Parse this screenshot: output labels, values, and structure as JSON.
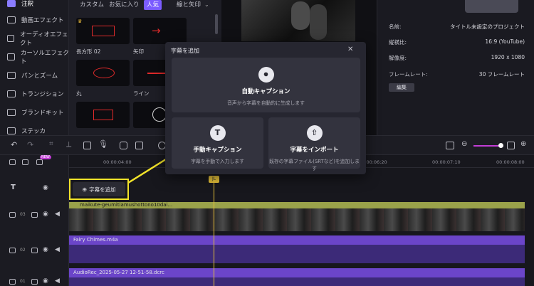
{
  "sidebar": {
    "items": [
      {
        "label": "注釈"
      },
      {
        "label": "動画エフェクト"
      },
      {
        "label": "オーディオエフェクト"
      },
      {
        "label": "カーソルエフェクト"
      },
      {
        "label": "パンとズーム"
      },
      {
        "label": "トランジション"
      },
      {
        "label": "ブランドキット"
      },
      {
        "label": "ステッカ"
      }
    ]
  },
  "assets": {
    "tabs": [
      "カスタム",
      "お気に入り",
      "人気",
      "線と矢印"
    ],
    "active_tab": "人気",
    "items": [
      {
        "label": "長方形 02"
      },
      {
        "label": "矢印"
      },
      {
        "label": "丸"
      },
      {
        "label": "ライン"
      }
    ]
  },
  "properties": {
    "rows": [
      {
        "label": "名前:",
        "value": "タイトル未設定のプロジェクト"
      },
      {
        "label": "縦横比:",
        "value": "16:9 (YouTube)"
      },
      {
        "label": "解像度:",
        "value": "1920 x 1080"
      },
      {
        "label": "フレームレート:",
        "value": "30 フレームレート"
      }
    ],
    "edit_label": "編集"
  },
  "toolbar": {
    "new_badge": "NEW"
  },
  "ruler": {
    "times": [
      "00:00:04:00",
      "00:00:06:20",
      "00:00:07:10",
      "00:00:08:00"
    ]
  },
  "dialog": {
    "title": "字幕を追加",
    "auto": {
      "title": "自動キャプション",
      "desc": "音声から字幕を自動的に生成します"
    },
    "manual": {
      "title": "手動キャプション",
      "desc": "字幕を手動で入力します"
    },
    "import": {
      "title": "字幕をインポート",
      "desc": "既存の字幕ファイル(SRTなど)を追加します"
    }
  },
  "timeline": {
    "add_caption": "字幕を追加",
    "playhead": "JL",
    "tracks": [
      {
        "num": "03",
        "clip": "maikute-geumitiamushottono10dai..."
      },
      {
        "num": "02",
        "clip": "Fairy Chimes.m4a"
      },
      {
        "num": "01",
        "clip": "AudioRec_2025-05-27 12-51-58.dcrc"
      }
    ]
  },
  "colors": {
    "accent": "#7b5cff",
    "highlight": "#f2e32a",
    "audio": "#6b45c9",
    "video_bar": "#9aa24a"
  }
}
